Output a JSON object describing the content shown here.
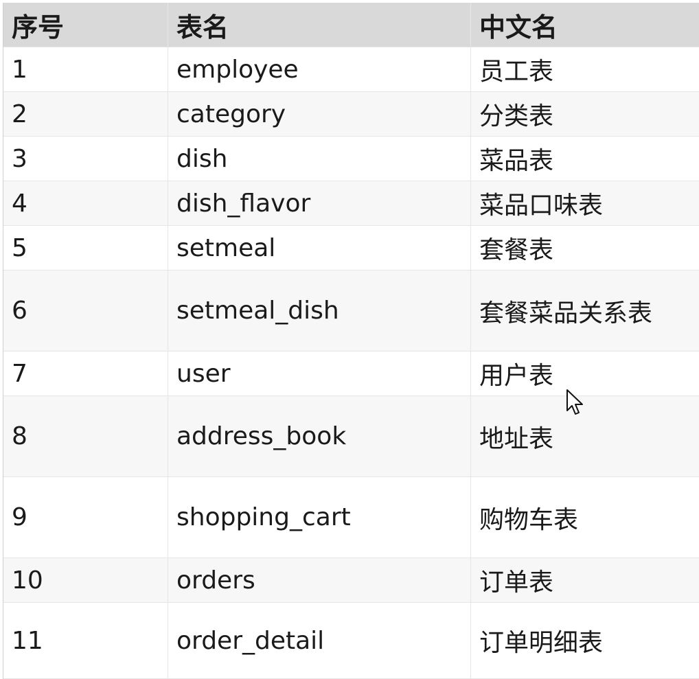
{
  "table": {
    "headers": [
      "序号",
      "表名",
      "中文名"
    ],
    "rows": [
      {
        "index": "1",
        "name": "employee",
        "cn": "员工表"
      },
      {
        "index": "2",
        "name": "category",
        "cn": "分类表"
      },
      {
        "index": "3",
        "name": "dish",
        "cn": "菜品表"
      },
      {
        "index": "4",
        "name": "dish_flavor",
        "cn": "菜品口味表"
      },
      {
        "index": "5",
        "name": "setmeal",
        "cn": "套餐表"
      },
      {
        "index": "6",
        "name": "setmeal_dish",
        "cn": "套餐菜品关系表"
      },
      {
        "index": "7",
        "name": "user",
        "cn": "用户表"
      },
      {
        "index": "8",
        "name": "address_book",
        "cn": "地址表"
      },
      {
        "index": "9",
        "name": "shopping_cart",
        "cn": "购物车表"
      },
      {
        "index": "10",
        "name": "orders",
        "cn": "订单表"
      },
      {
        "index": "11",
        "name": "order_detail",
        "cn": "订单明细表"
      }
    ]
  },
  "icons": {
    "cursor": "mouse-pointer-icon"
  },
  "colors": {
    "header_bg": "#d9d9d9",
    "row_alt_bg": "#f7f7f7",
    "text": "#1a1a1a"
  }
}
